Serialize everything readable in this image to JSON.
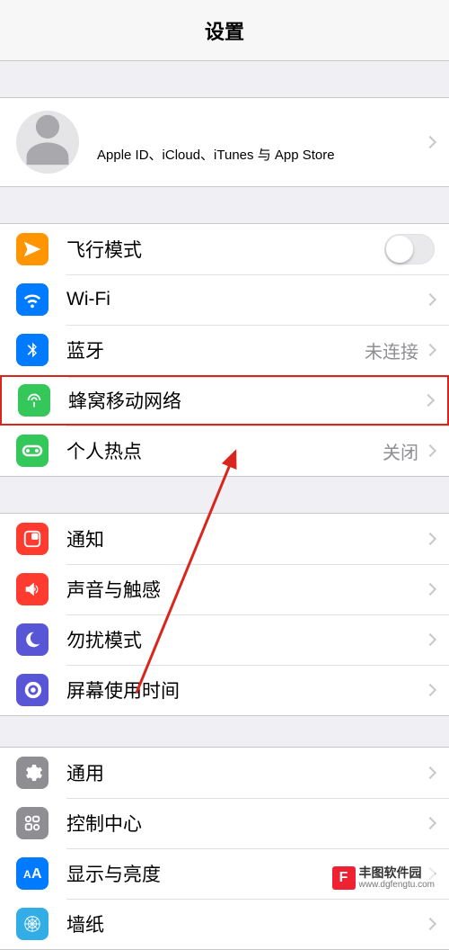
{
  "header": {
    "title": "设置"
  },
  "profile": {
    "name": "",
    "subtitle": "Apple ID、iCloud、iTunes 与 App Store"
  },
  "group1": {
    "airplane": {
      "label": "飞行模式"
    },
    "wifi": {
      "label": "Wi-Fi",
      "value": ""
    },
    "bluetooth": {
      "label": "蓝牙",
      "value": "未连接"
    },
    "cellular": {
      "label": "蜂窝移动网络"
    },
    "hotspot": {
      "label": "个人热点",
      "value": "关闭"
    }
  },
  "group2": {
    "notifications": {
      "label": "通知"
    },
    "sounds": {
      "label": "声音与触感"
    },
    "dnd": {
      "label": "勿扰模式"
    },
    "screentime": {
      "label": "屏幕使用时间"
    }
  },
  "group3": {
    "general": {
      "label": "通用"
    },
    "controlcenter": {
      "label": "控制中心"
    },
    "display": {
      "label": "显示与亮度"
    },
    "wallpaper": {
      "label": "墙纸"
    }
  },
  "watermark": {
    "brand": "丰图软件园",
    "url": "www.dgfengtu.com",
    "logo": "F"
  }
}
